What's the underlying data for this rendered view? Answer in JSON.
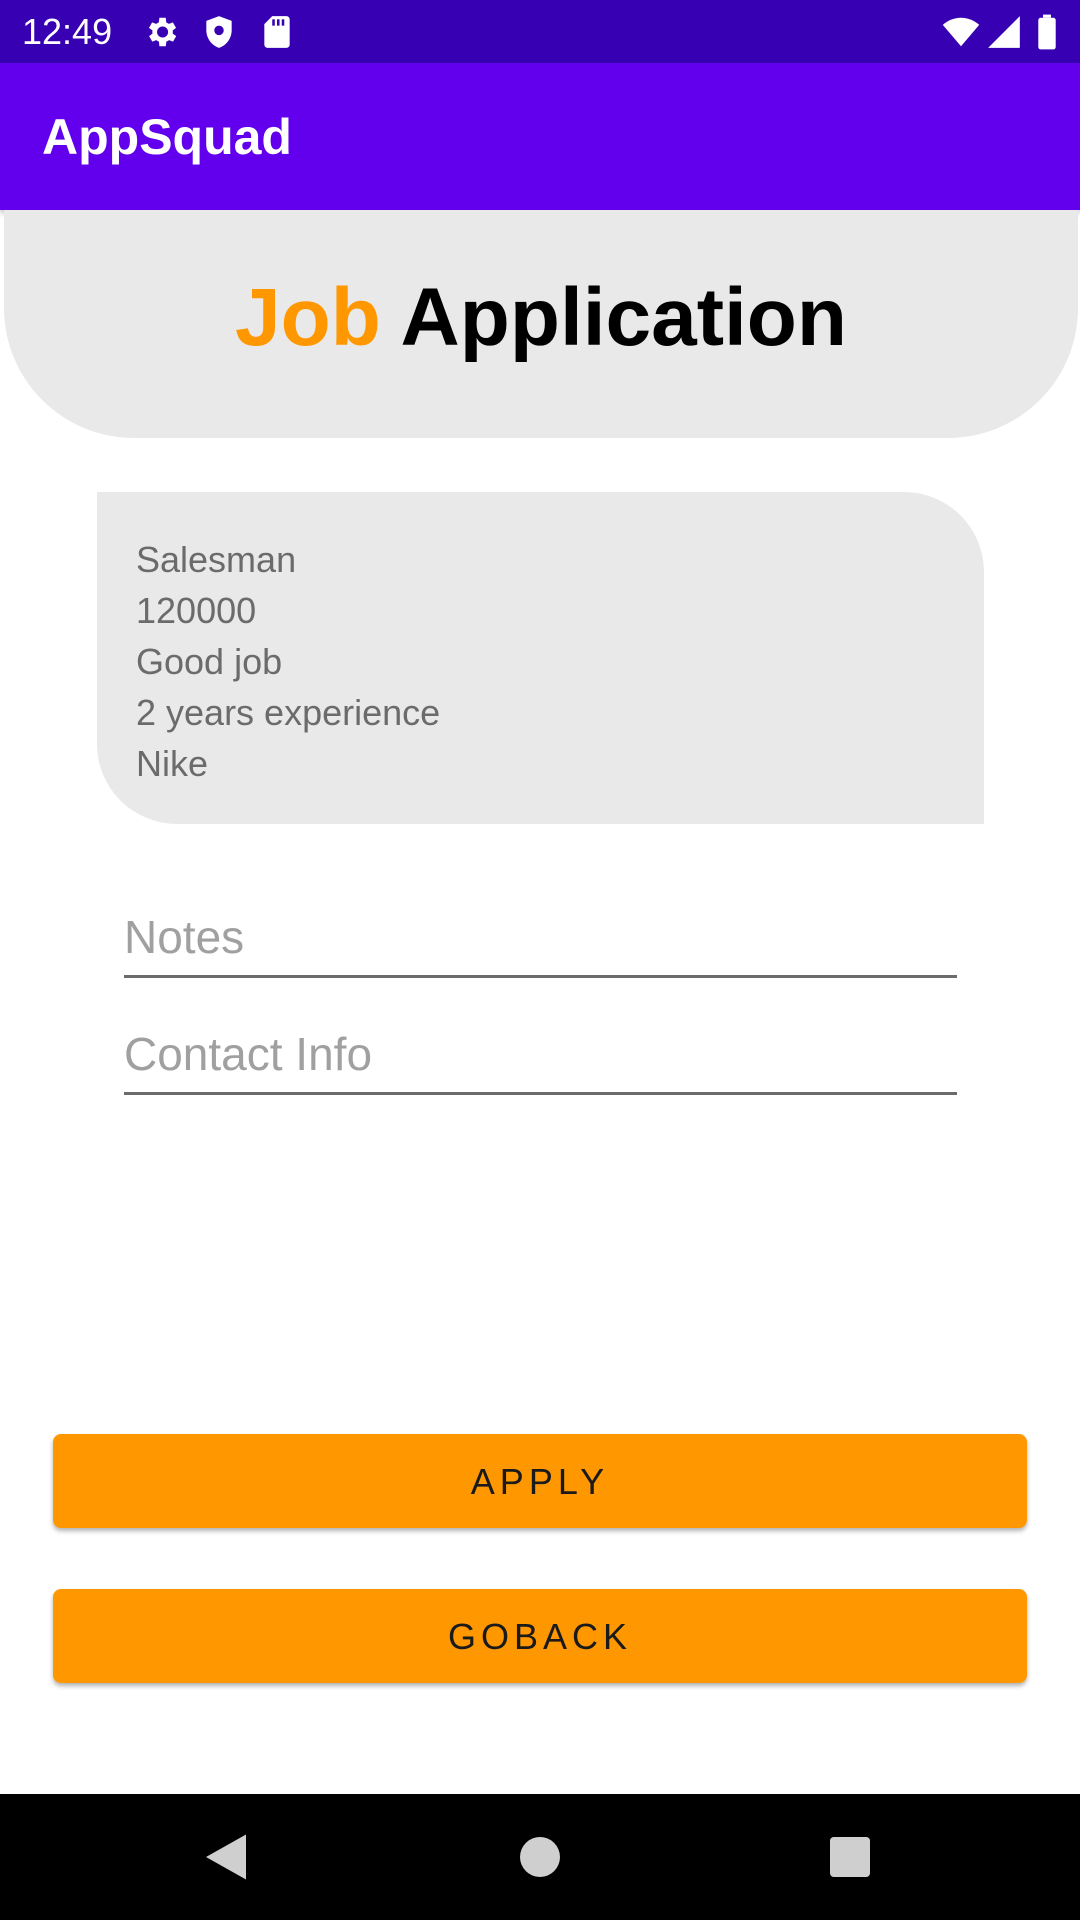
{
  "status_bar": {
    "time": "12:49",
    "left_icons": [
      "gear-icon",
      "shield-icon",
      "sd-card-icon"
    ],
    "right_icons": [
      "wifi-icon",
      "signal-icon",
      "battery-icon"
    ]
  },
  "app_bar": {
    "title": "AppSquad"
  },
  "header": {
    "title_accent": "Job",
    "title_main": "Application",
    "accent_color": "#ff9800"
  },
  "job_details": {
    "items": [
      "Salesman",
      "120000",
      "Good job",
      "2 years experience",
      "Nike"
    ]
  },
  "form": {
    "notes": {
      "value": "",
      "placeholder": "Notes"
    },
    "contact": {
      "value": "",
      "placeholder": "Contact Info"
    }
  },
  "actions": {
    "apply_label": "APPLY",
    "goback_label": "GOBACK"
  },
  "nav_bar": {
    "icons": [
      "back-icon",
      "home-icon",
      "recents-icon"
    ]
  },
  "colors": {
    "status_bar": "#3700b3",
    "app_bar": "#6200ee",
    "button": "#ff9800",
    "card": "#e9e9e9"
  }
}
